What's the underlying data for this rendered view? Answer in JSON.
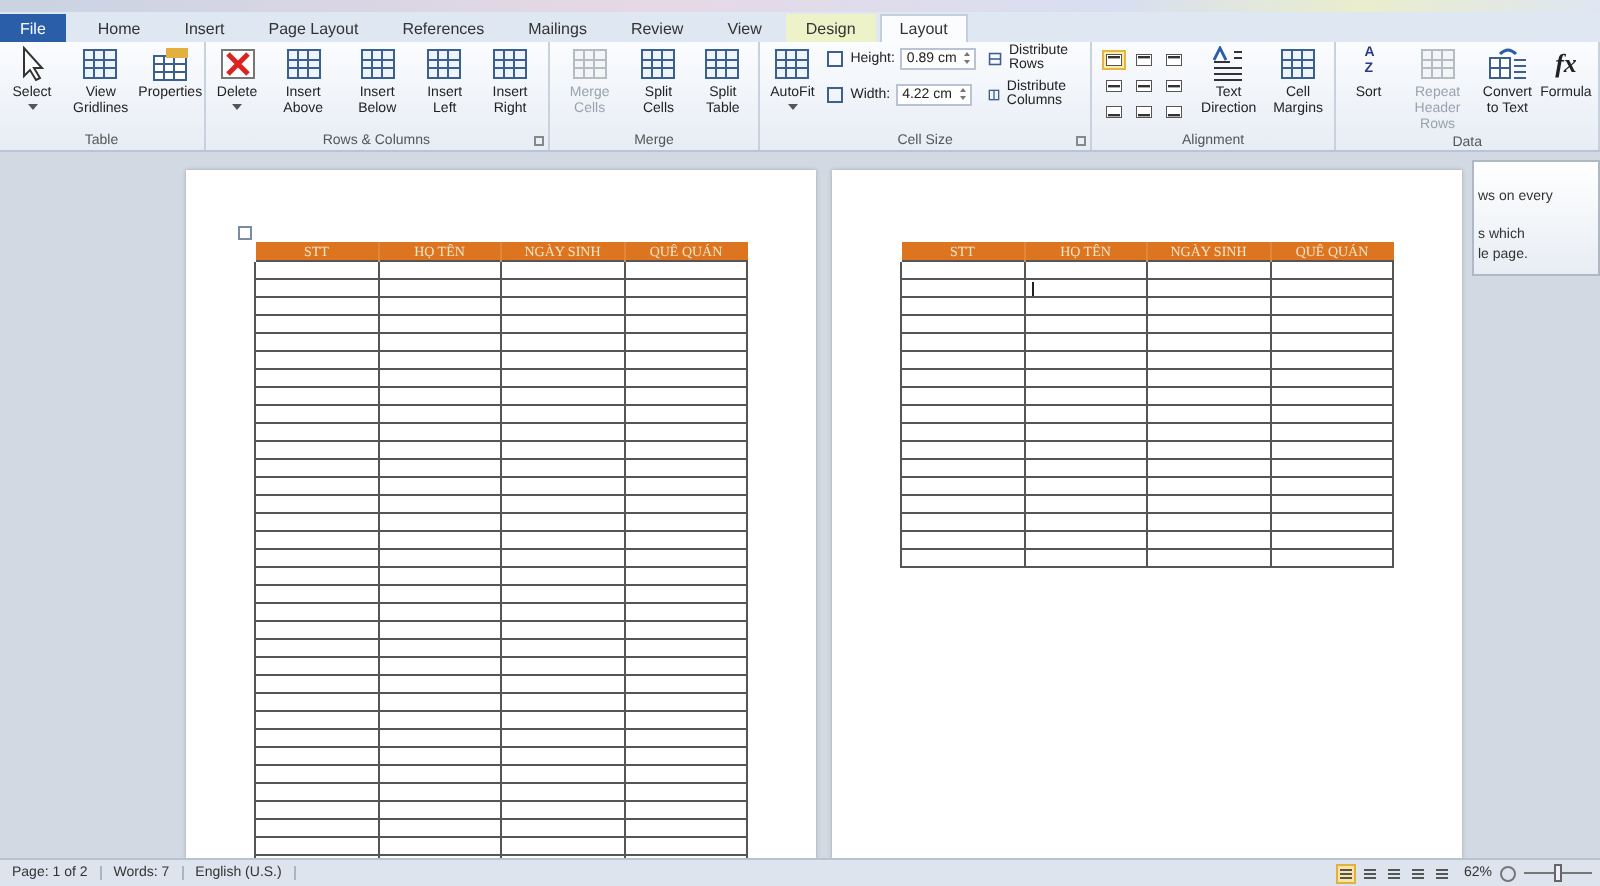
{
  "tabs": [
    {
      "label": "File",
      "selected": false,
      "kind": "file"
    },
    {
      "label": "Home",
      "selected": false,
      "kind": "plain"
    },
    {
      "label": "Insert",
      "selected": false,
      "kind": "plain"
    },
    {
      "label": "Page Layout",
      "selected": false,
      "kind": "plain"
    },
    {
      "label": "References",
      "selected": false,
      "kind": "plain"
    },
    {
      "label": "Mailings",
      "selected": false,
      "kind": "plain"
    },
    {
      "label": "Review",
      "selected": false,
      "kind": "plain"
    },
    {
      "label": "View",
      "selected": false,
      "kind": "plain"
    },
    {
      "label": "Design",
      "selected": false,
      "kind": "context"
    },
    {
      "label": "Layout",
      "selected": true,
      "kind": "context"
    }
  ],
  "ribbon": [
    {
      "label": "Table",
      "launcher": false,
      "items": [
        {
          "kind": "large",
          "label": "Select",
          "disabled": false,
          "dropdown": true
        },
        {
          "kind": "large",
          "label": "View Gridlines",
          "disabled": false,
          "dropdown": false
        },
        {
          "kind": "large",
          "label": "Properties",
          "disabled": false,
          "dropdown": false
        }
      ]
    },
    {
      "label": "Rows & Columns",
      "launcher": true,
      "items": [
        {
          "kind": "large",
          "label": "Delete",
          "disabled": false,
          "dropdown": true
        },
        {
          "kind": "large",
          "label": "Insert Above",
          "disabled": false,
          "dropdown": false
        },
        {
          "kind": "large",
          "label": "Insert Below",
          "disabled": false,
          "dropdown": false
        },
        {
          "kind": "large",
          "label": "Insert Left",
          "disabled": false,
          "dropdown": false
        },
        {
          "kind": "large",
          "label": "Insert Right",
          "disabled": false,
          "dropdown": false
        }
      ]
    },
    {
      "label": "Merge",
      "launcher": false,
      "items": [
        {
          "kind": "large",
          "label": "Merge Cells",
          "disabled": true,
          "dropdown": false
        },
        {
          "kind": "large",
          "label": "Split Cells",
          "disabled": false,
          "dropdown": false
        },
        {
          "kind": "large",
          "label": "Split Table",
          "disabled": false,
          "dropdown": false
        }
      ]
    },
    {
      "label": "Cell Size",
      "launcher": true,
      "items": [
        {
          "kind": "large",
          "label": "AutoFit",
          "disabled": false,
          "dropdown": true
        },
        {
          "kind": "sizes",
          "fields": [
            {
              "label": "Height:",
              "value": "0.89 cm"
            },
            {
              "label": "Width:",
              "value": "4.22 cm"
            }
          ],
          "links": [
            "Distribute Rows",
            "Distribute Columns"
          ]
        }
      ]
    },
    {
      "label": "Alignment",
      "launcher": false,
      "items": [
        {
          "kind": "align",
          "cells": [
            {
              "selected": true
            },
            {
              "selected": false
            },
            {
              "selected": false
            },
            {
              "selected": false
            },
            {
              "selected": false
            },
            {
              "selected": false
            },
            {
              "selected": false
            },
            {
              "selected": false
            },
            {
              "selected": false
            }
          ]
        },
        {
          "kind": "large",
          "label": "Text Direction",
          "disabled": false,
          "dropdown": false
        },
        {
          "kind": "large",
          "label": "Cell Margins",
          "disabled": false,
          "dropdown": false
        }
      ]
    },
    {
      "label": "Data",
      "launcher": false,
      "items": [
        {
          "kind": "large",
          "label": "Sort",
          "disabled": false,
          "dropdown": false,
          "glyph": "AZ"
        },
        {
          "kind": "large",
          "label": "Repeat Header Rows",
          "disabled": true,
          "dropdown": false
        },
        {
          "kind": "large",
          "label": "Convert to Text",
          "disabled": false,
          "dropdown": false
        },
        {
          "kind": "large",
          "label": "Formula",
          "disabled": false,
          "dropdown": false,
          "glyph": "fx"
        }
      ]
    }
  ],
  "tooltip": {
    "lines": [
      "ws on every",
      "s which",
      "le page."
    ]
  },
  "pages": [
    {
      "table": {
        "columns": [
          "STT",
          "HỌ TÊN",
          "NGÀY SINH",
          "QUÊ QUÁN"
        ]
      },
      "cursor": false
    },
    {
      "table": {
        "columns": [
          "STT",
          "HỌ TÊN",
          "NGÀY SINH",
          "QUÊ QUÁN"
        ]
      },
      "cursor": true
    }
  ],
  "status_bar": {
    "items": [
      "Page: 1 of 2",
      "Words: 7",
      "English (U.S.)"
    ],
    "views": [
      {
        "selected": true
      },
      {
        "selected": false
      },
      {
        "selected": false
      },
      {
        "selected": false
      },
      {
        "selected": false
      }
    ],
    "zoom": "62%",
    "zoom_level": {
      "level": 0.5
    }
  }
}
